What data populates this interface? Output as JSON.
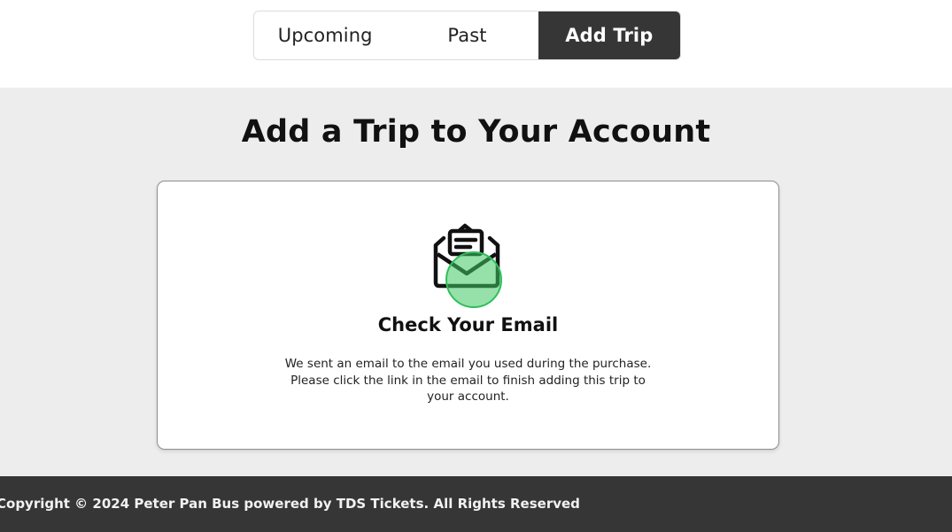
{
  "tabs": {
    "items": [
      {
        "label": "Upcoming",
        "active": false
      },
      {
        "label": "Past",
        "active": false
      },
      {
        "label": "Add Trip",
        "active": true
      }
    ]
  },
  "main": {
    "heading": "Add a Trip to Your Account",
    "card": {
      "icon": "envelope-open-icon",
      "title": "Check Your Email",
      "body_line1": "We sent an email to the email you used during the purchase.",
      "body_line2": "Please click the link in the email to finish adding this trip to your account."
    }
  },
  "footer": {
    "copyright": "Copyright © 2024 Peter Pan Bus powered by TDS Tickets. All Rights Reserved"
  },
  "colors": {
    "dark": "#363636",
    "background": "#ededed",
    "click_indicator": "#2fbf5a"
  }
}
